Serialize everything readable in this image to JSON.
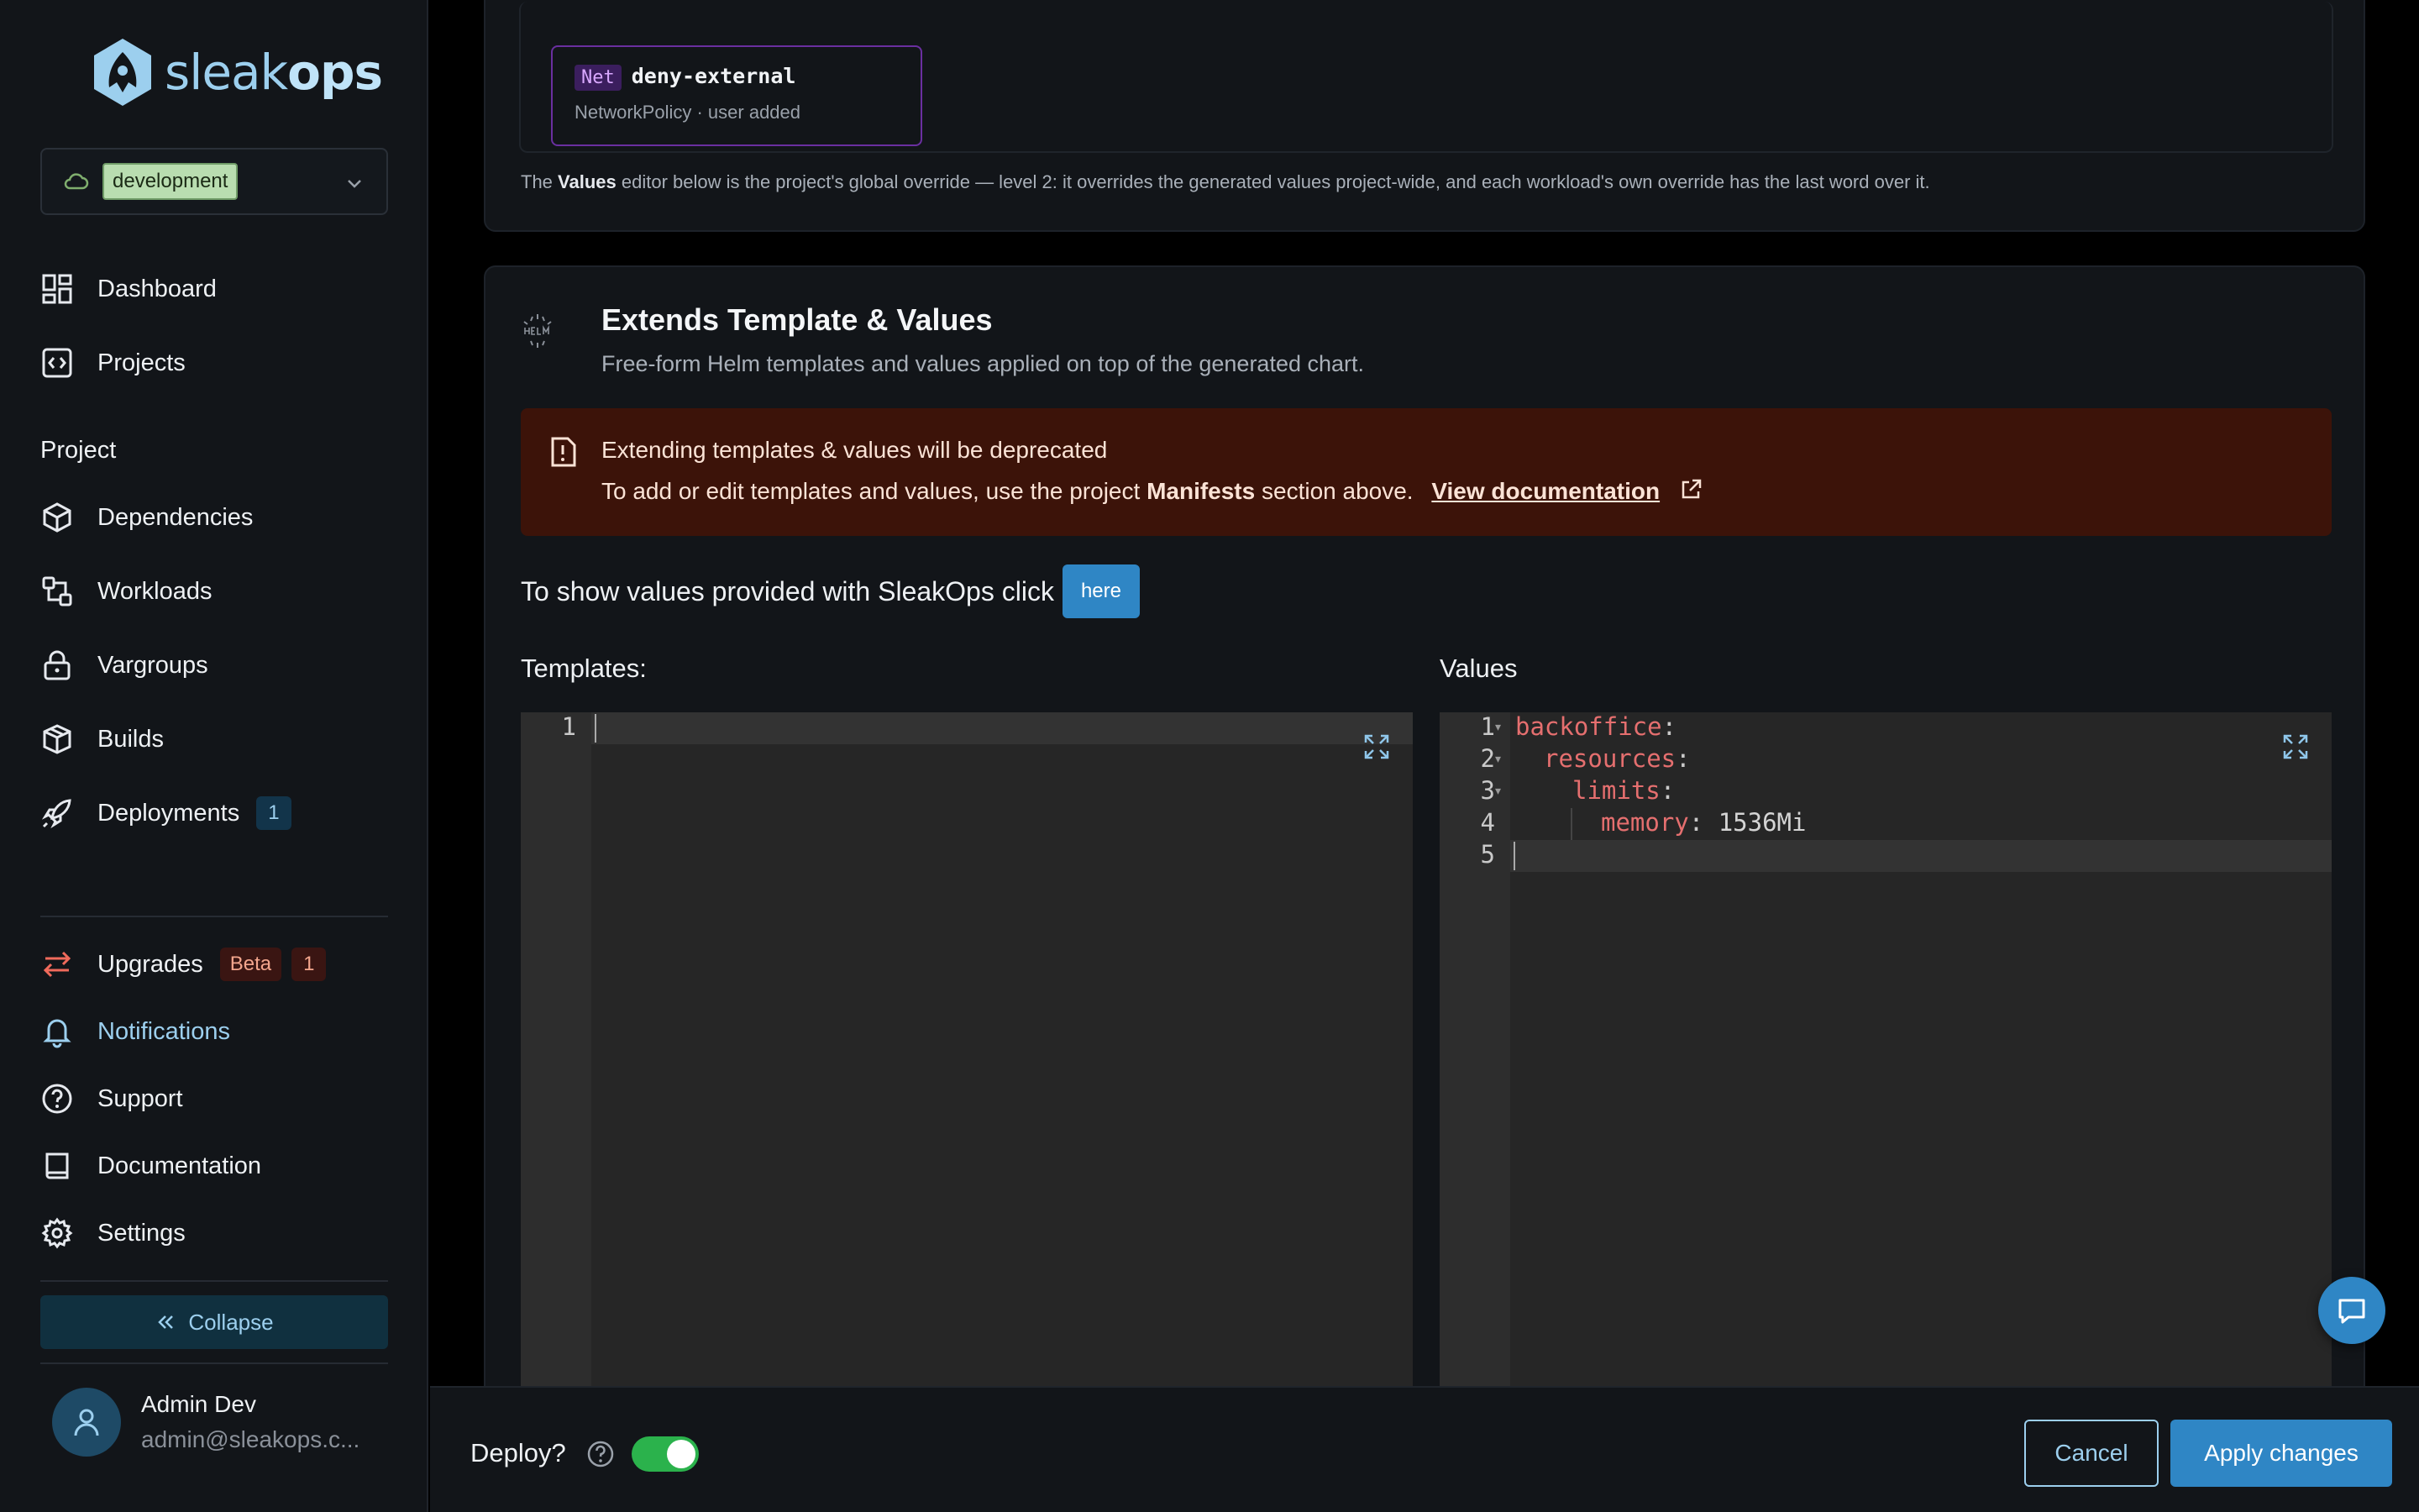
{
  "brand": {
    "logo_light": "sleak",
    "logo_bold": "ops"
  },
  "environment": {
    "selected": "development"
  },
  "nav": {
    "dashboard": "Dashboard",
    "projects": "Projects",
    "section_project": "Project",
    "dependencies": "Dependencies",
    "workloads": "Workloads",
    "vargroups": "Vargroups",
    "builds": "Builds",
    "deployments": "Deployments",
    "deployments_count": "1",
    "upgrades": "Upgrades",
    "upgrades_badge": "Beta",
    "upgrades_count": "1",
    "notifications": "Notifications",
    "support": "Support",
    "documentation": "Documentation",
    "settings": "Settings",
    "collapse": "Collapse"
  },
  "user": {
    "name": "Admin Dev",
    "email": "admin@sleakops.c..."
  },
  "manifest_card": {
    "tag": "Net",
    "name": "deny-external",
    "meta": "NetworkPolicy · user added",
    "note_prefix": "The ",
    "note_bold": "Values",
    "note_suffix": " editor below is the project's global override — level 2: it overrides the generated values project-wide, and each workload's own override has the last word over it."
  },
  "extends": {
    "title": "Extends Template & Values",
    "subtitle": "Free-form Helm templates and values applied on top of the generated chart.",
    "alert_title": "Extending templates & values will be deprecated",
    "alert_body_prefix": "To add or edit templates and values, use the project ",
    "alert_body_bold": "Manifests",
    "alert_body_suffix": " section above.",
    "alert_link": "View documentation",
    "show_values_text": "To show values provided with SleakOps click",
    "here_button": "here",
    "templates_label": "Templates:",
    "values_label": "Values",
    "templates_lines": [
      "1"
    ],
    "values_lines": [
      "1",
      "2",
      "3",
      "4",
      "5"
    ],
    "values_code": [
      {
        "key": "backoffice",
        "sep": ":",
        "value": ""
      },
      {
        "key": "resources",
        "sep": ":",
        "value": ""
      },
      {
        "key": "limits",
        "sep": ":",
        "value": ""
      },
      {
        "key": "memory",
        "sep": ":",
        "value": " 1536Mi"
      }
    ]
  },
  "footer": {
    "deploy_label": "Deploy?",
    "deploy_enabled": true,
    "cancel": "Cancel",
    "apply": "Apply changes"
  },
  "colors": {
    "accent": "#2f86c5",
    "accent_light": "#9ccfee",
    "alert_bg": "#3c1309",
    "toggle_on": "#2bb24c",
    "yaml_key": "#e56f6f",
    "net_border": "#6a2fa0"
  }
}
